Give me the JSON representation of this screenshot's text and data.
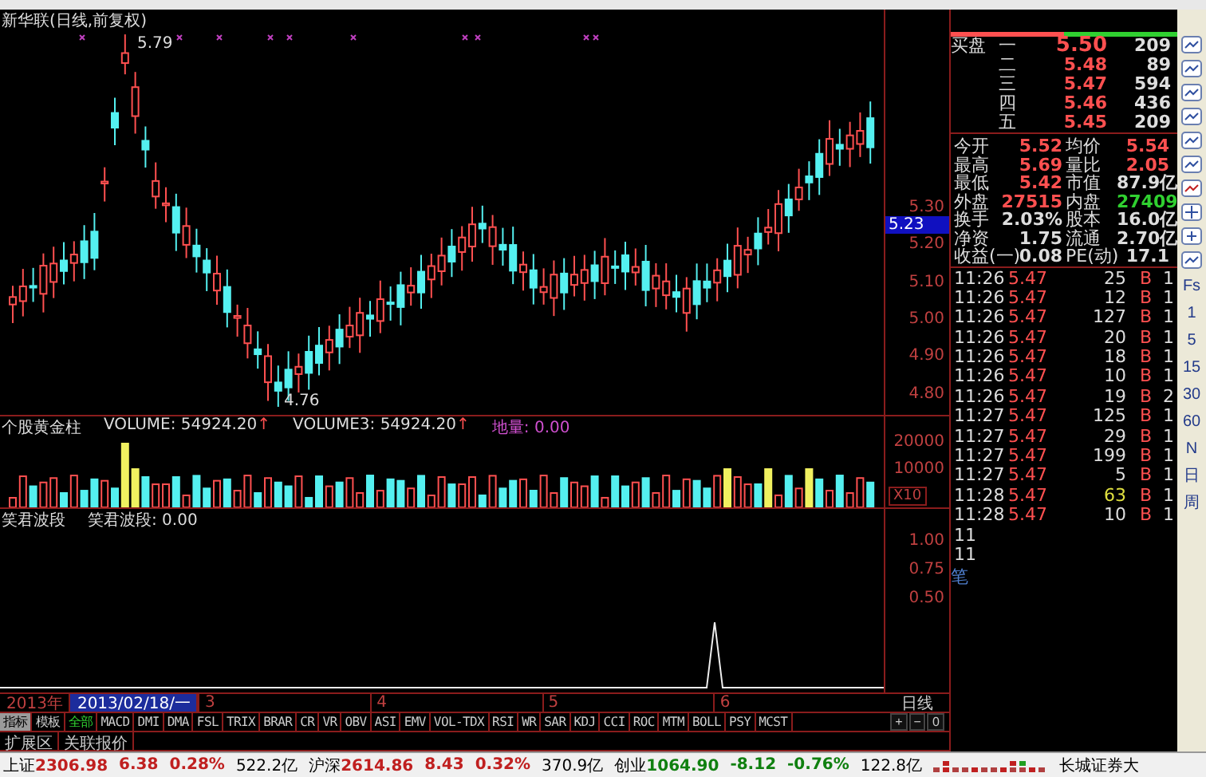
{
  "chart": {
    "title": "新华联(日线,前复权)",
    "high_label": "5.79",
    "low_label": "4.76",
    "price_axis": [
      "5.30",
      "5.20",
      "5.10",
      "5.00",
      "4.90",
      "4.80"
    ],
    "current_price": "5.23"
  },
  "volume_pane": {
    "name": "个股黄金柱",
    "items": [
      {
        "label": "VOLUME: 54924.20",
        "arrow": "↑",
        "kind": "plain"
      },
      {
        "label": "VOLUME3: 54924.20",
        "arrow": "↑",
        "kind": "plain"
      },
      {
        "label": "地量: 0.00",
        "kind": "accent"
      }
    ],
    "axis": [
      "20000",
      "10000"
    ],
    "scale": "X10"
  },
  "indicator_pane": {
    "name": "笑君波段",
    "items": [
      {
        "label": "笑君波段: 0.00"
      }
    ],
    "axis": [
      "1.00",
      "0.75",
      "0.50"
    ]
  },
  "date_axis": {
    "year": "2013年",
    "cursor": "2013/02/18/一",
    "months": [
      "3",
      "4",
      "5",
      "6"
    ],
    "period": "日线",
    "zoom_buttons": [
      "+",
      "−",
      "0"
    ]
  },
  "indicator_tabs": [
    {
      "label": "指标",
      "selected": true,
      "kind": "group"
    },
    {
      "label": "模板",
      "selected": false,
      "kind": "group"
    },
    {
      "label": "全部",
      "selected": false,
      "kind": "all"
    },
    {
      "label": "MACD",
      "selected": false,
      "kind": "ind"
    },
    {
      "label": "DMI",
      "selected": false,
      "kind": "ind"
    },
    {
      "label": "DMA",
      "selected": false,
      "kind": "ind"
    },
    {
      "label": "FSL",
      "selected": false,
      "kind": "ind"
    },
    {
      "label": "TRIX",
      "selected": false,
      "kind": "ind"
    },
    {
      "label": "BRAR",
      "selected": false,
      "kind": "ind"
    },
    {
      "label": "CR",
      "selected": false,
      "kind": "ind"
    },
    {
      "label": "VR",
      "selected": false,
      "kind": "ind"
    },
    {
      "label": "OBV",
      "selected": false,
      "kind": "ind"
    },
    {
      "label": "ASI",
      "selected": false,
      "kind": "ind"
    },
    {
      "label": "EMV",
      "selected": false,
      "kind": "ind"
    },
    {
      "label": "VOL-TDX",
      "selected": false,
      "kind": "ind"
    },
    {
      "label": "RSI",
      "selected": false,
      "kind": "ind"
    },
    {
      "label": "WR",
      "selected": false,
      "kind": "ind"
    },
    {
      "label": "SAR",
      "selected": false,
      "kind": "ind"
    },
    {
      "label": "KDJ",
      "selected": false,
      "kind": "ind"
    },
    {
      "label": "CCI",
      "selected": false,
      "kind": "ind"
    },
    {
      "label": "ROC",
      "selected": false,
      "kind": "ind"
    },
    {
      "label": "MTM",
      "selected": false,
      "kind": "ind"
    },
    {
      "label": "BOLL",
      "selected": false,
      "kind": "ind"
    },
    {
      "label": "PSY",
      "selected": false,
      "kind": "ind"
    },
    {
      "label": "MCST",
      "selected": false,
      "kind": "ind"
    }
  ],
  "extra_tabs": [
    "扩展区",
    "关联报价"
  ],
  "bids": {
    "label": "买盘",
    "levels": [
      {
        "level": "一",
        "price": "5.50",
        "volume": "209"
      },
      {
        "level": "二",
        "price": "5.48",
        "volume": "89"
      },
      {
        "level": "三",
        "price": "5.47",
        "volume": "594"
      },
      {
        "level": "四",
        "price": "5.46",
        "volume": "436"
      },
      {
        "level": "五",
        "price": "5.45",
        "volume": "209"
      }
    ]
  },
  "stats": [
    [
      {
        "label": "今开",
        "value": "5.52",
        "color": "#ff5050"
      },
      {
        "label": "均价",
        "value": "5.54",
        "color": "#ff5050"
      }
    ],
    [
      {
        "label": "最高",
        "value": "5.69",
        "color": "#ff5050"
      },
      {
        "label": "量比",
        "value": "2.05",
        "color": "#ff5050"
      }
    ],
    [
      {
        "label": "最低",
        "value": "5.42",
        "color": "#ff5050"
      },
      {
        "label": "市值",
        "value": "87.9亿",
        "color": "#dddddd"
      }
    ],
    [
      {
        "label": "外盘",
        "value": "27515",
        "color": "#ff5050"
      },
      {
        "label": "内盘",
        "value": "27409",
        "color": "#30d030"
      }
    ],
    [
      {
        "label": "换手",
        "value": "2.03%",
        "color": "#dddddd"
      },
      {
        "label": "股本",
        "value": "16.0亿",
        "color": "#dddddd"
      }
    ],
    [
      {
        "label": "净资",
        "value": "1.75",
        "color": "#dddddd"
      },
      {
        "label": "流通",
        "value": "2.70亿",
        "color": "#dddddd"
      }
    ],
    [
      {
        "label": "收益(一)",
        "value": "0.08",
        "color": "#dddddd"
      },
      {
        "label": "PE(动)",
        "value": "17.1",
        "color": "#dddddd"
      }
    ]
  ],
  "ticks": [
    {
      "time": "11:26",
      "price": "5.47",
      "volume": "25",
      "side": "B",
      "count": "1",
      "color": "#dddddd"
    },
    {
      "time": "11:26",
      "price": "5.47",
      "volume": "12",
      "side": "B",
      "count": "1",
      "color": "#dddddd"
    },
    {
      "time": "11:26",
      "price": "5.47",
      "volume": "127",
      "side": "B",
      "count": "1",
      "color": "#dddddd"
    },
    {
      "time": "11:26",
      "price": "5.47",
      "volume": "20",
      "side": "B",
      "count": "1",
      "color": "#dddddd"
    },
    {
      "time": "11:26",
      "price": "5.47",
      "volume": "18",
      "side": "B",
      "count": "1",
      "color": "#dddddd"
    },
    {
      "time": "11:26",
      "price": "5.47",
      "volume": "10",
      "side": "B",
      "count": "1",
      "color": "#dddddd"
    },
    {
      "time": "11:26",
      "price": "5.47",
      "volume": "19",
      "side": "B",
      "count": "2",
      "color": "#dddddd"
    },
    {
      "time": "11:27",
      "price": "5.47",
      "volume": "125",
      "side": "B",
      "count": "1",
      "color": "#dddddd"
    },
    {
      "time": "11:27",
      "price": "5.47",
      "volume": "29",
      "side": "B",
      "count": "1",
      "color": "#dddddd"
    },
    {
      "time": "11:27",
      "price": "5.47",
      "volume": "199",
      "side": "B",
      "count": "1",
      "color": "#dddddd"
    },
    {
      "time": "11:27",
      "price": "5.47",
      "volume": "5",
      "side": "B",
      "count": "1",
      "color": "#dddddd"
    },
    {
      "time": "11:28",
      "price": "5.47",
      "volume": "63",
      "side": "B",
      "count": "1",
      "color": "#e0e040"
    },
    {
      "time": "11:28",
      "price": "5.47",
      "volume": "10",
      "side": "B",
      "count": "1",
      "color": "#dddddd"
    },
    {
      "time": "11"
    },
    {
      "time": "11"
    }
  ],
  "tick_footer": "笔",
  "tool_buttons": [
    "Fs",
    "1",
    "5",
    "15",
    "30",
    "60",
    "N",
    "日",
    "周"
  ],
  "status_bar": {
    "indices": [
      {
        "name": "上证",
        "value": "2306.98",
        "change": "6.38",
        "percent": "0.28%",
        "amount": "522.2亿",
        "color": "#c02020"
      },
      {
        "name": "沪深",
        "value": "2614.86",
        "change": "8.43",
        "percent": "0.32%",
        "amount": "370.9亿",
        "color": "#c02020"
      },
      {
        "name": "创业",
        "value": "1064.90",
        "change": "-8.12",
        "percent": "-0.76%",
        "amount": "122.8亿",
        "color": "#108010"
      }
    ],
    "broker": "长城证券大"
  }
}
